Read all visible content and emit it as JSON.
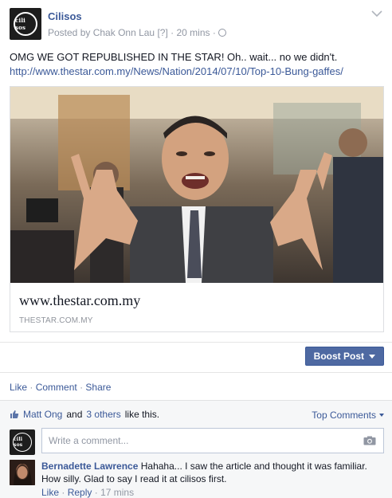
{
  "post": {
    "page_name": "Cilisos",
    "avatar_text": "cili sos",
    "posted_by_prefix": "Posted by",
    "author": "Chak Onn Lau",
    "help_marker": "[?]",
    "time": "20 mins",
    "text": "OMG WE GOT REPUBLISHED IN THE STAR! Oh.. wait... no we didn't.",
    "url": "http://www.thestar.com.my/News/Nation/2014/07/10/Top-10-Bung-gaffes/"
  },
  "link_card": {
    "title": "www.thestar.com.my",
    "domain": "THESTAR.COM.MY"
  },
  "boost": {
    "label": "Boost Post"
  },
  "actions": {
    "like": "Like",
    "comment": "Comment",
    "share": "Share",
    "separator": "·"
  },
  "likes": {
    "liker": "Matt Ong",
    "and": "and",
    "others": "3 others",
    "suffix": "like this."
  },
  "top_comments": {
    "label": "Top Comments"
  },
  "comment_box": {
    "placeholder": "Write a comment..."
  },
  "comment": {
    "name": "Bernadette Lawrence",
    "text": "Hahaha... I saw the article and thought it was familiar. How silly. Glad to say I read it at cilisos first.",
    "like": "Like",
    "reply": "Reply",
    "time": "17 mins"
  },
  "colors": {
    "link": "#3b5998",
    "boost_bg": "#4e69a2",
    "meta": "#9197a3"
  },
  "icons": [
    "chevron-down-icon",
    "globe-icon",
    "thumbs-up-icon",
    "camera-icon",
    "caret-down-icon"
  ]
}
